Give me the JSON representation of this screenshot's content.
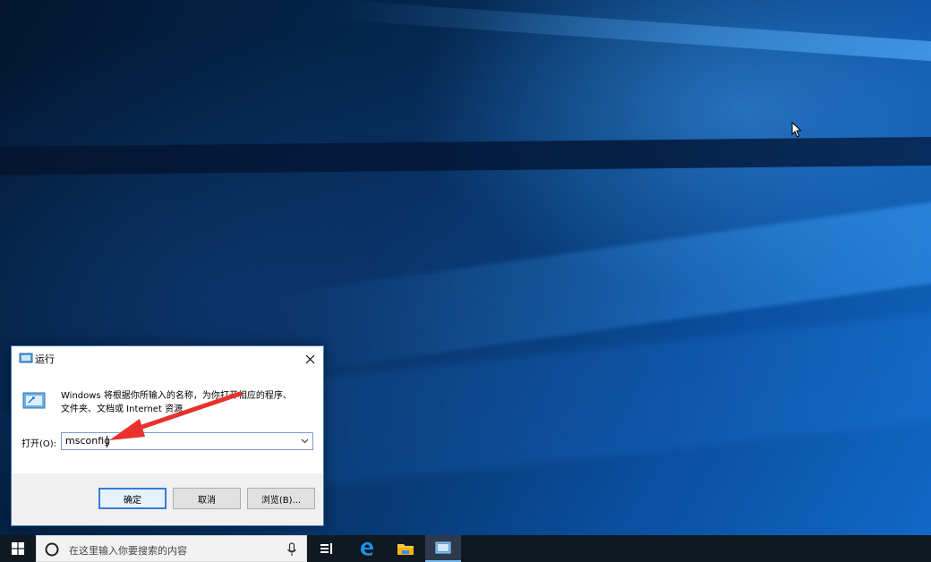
{
  "dialog": {
    "title": "运行",
    "description_line1": "Windows 将根据你所输入的名称，为你打开相应的程序、",
    "description_line2": "文件夹、文档或 Internet 资源",
    "open_label": "打开(O):",
    "input_value": "msconfig",
    "buttons": {
      "ok": "确定",
      "cancel": "取消",
      "browse": "浏览(B)..."
    }
  },
  "taskbar": {
    "search_placeholder": "在这里输入你要搜索的内容",
    "items": [
      "start-icon",
      "task-view-icon",
      "edge-icon",
      "file-explorer-icon",
      "run-icon"
    ]
  },
  "colors": {
    "accent": "#3a7bd5",
    "annotation_arrow": "#e8312a",
    "taskbar": "#101822"
  }
}
